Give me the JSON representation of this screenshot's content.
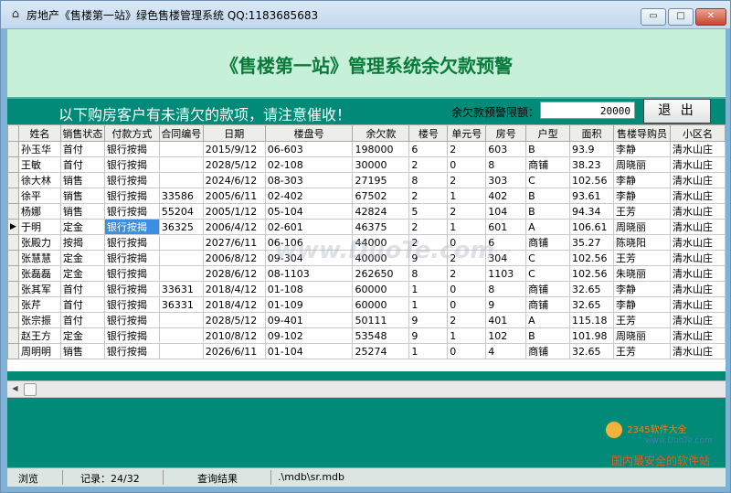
{
  "window": {
    "title": "房地产《售楼第一站》绿色售楼管理系统  QQ:1183685683",
    "minimize": "▭",
    "maximize": "□",
    "close": "✕"
  },
  "banner": {
    "title": "《售楼第一站》管理系统余欠款预警"
  },
  "toolbar": {
    "notice": "以下购房客户有未清欠的款项，请注意催收！",
    "threshold_label": "余欠款预警限额：",
    "threshold_value": "20000",
    "exit_label": "退 出"
  },
  "table": {
    "columns": [
      "姓名",
      "销售状态",
      "付款方式",
      "合同编号",
      "日期",
      "楼盘号",
      "余欠款",
      "楼号",
      "单元号",
      "房号",
      "户型",
      "面积",
      "售楼导购员",
      "小区名"
    ],
    "rows": [
      [
        "孙玉华",
        "首付",
        "银行按揭",
        "",
        "2015/9/12",
        "06-603",
        "198000",
        "6",
        "2",
        "603",
        "B",
        "93.9",
        "李静",
        "清水山庄"
      ],
      [
        "王敏",
        "首付",
        "银行按揭",
        "",
        "2028/5/12",
        "02-108",
        "30000",
        "2",
        "0",
        "8",
        "商铺",
        "38.23",
        "周晓丽",
        "清水山庄"
      ],
      [
        "徐大林",
        "销售",
        "银行按揭",
        "",
        "2024/6/12",
        "08-303",
        "27195",
        "8",
        "2",
        "303",
        "C",
        "102.56",
        "李静",
        "清水山庄"
      ],
      [
        "徐平",
        "销售",
        "银行按揭",
        "33586",
        "2005/6/11",
        "02-402",
        "67502",
        "2",
        "1",
        "402",
        "B",
        "93.61",
        "李静",
        "清水山庄"
      ],
      [
        "杨娜",
        "销售",
        "银行按揭",
        "55204",
        "2005/1/12",
        "05-104",
        "42824",
        "5",
        "2",
        "104",
        "B",
        "94.34",
        "王芳",
        "清水山庄"
      ],
      [
        "于明",
        "定金",
        "银行按揭",
        "36325",
        "2006/4/12",
        "02-601",
        "46375",
        "2",
        "1",
        "601",
        "A",
        "106.61",
        "周晓丽",
        "清水山庄"
      ],
      [
        "张殿力",
        "按揭",
        "银行按揭",
        "",
        "2027/6/11",
        "06-106",
        "44000",
        "2",
        "0",
        "6",
        "商铺",
        "35.27",
        "陈晓阳",
        "清水山庄"
      ],
      [
        "张慧慧",
        "定金",
        "银行按揭",
        "",
        "2006/8/12",
        "09-304",
        "40000",
        "9",
        "2",
        "304",
        "C",
        "102.56",
        "王芳",
        "清水山庄"
      ],
      [
        "张磊磊",
        "定金",
        "银行按揭",
        "",
        "2028/6/12",
        "08-1103",
        "262650",
        "8",
        "2",
        "1103",
        "C",
        "102.56",
        "朱晓丽",
        "清水山庄"
      ],
      [
        "张其军",
        "首付",
        "银行按揭",
        "33631",
        "2018/4/12",
        "01-108",
        "60000",
        "1",
        "0",
        "8",
        "商铺",
        "32.65",
        "李静",
        "清水山庄"
      ],
      [
        "张芹",
        "首付",
        "银行按揭",
        "36331",
        "2018/4/12",
        "01-109",
        "60000",
        "1",
        "0",
        "9",
        "商铺",
        "32.65",
        "李静",
        "清水山庄"
      ],
      [
        "张宗振",
        "首付",
        "银行按揭",
        "",
        "2028/5/12",
        "09-401",
        "50111",
        "9",
        "2",
        "401",
        "A",
        "115.18",
        "王芳",
        "清水山庄"
      ],
      [
        "赵王方",
        "定金",
        "银行按揭",
        "",
        "2010/8/12",
        "09-102",
        "53548",
        "9",
        "1",
        "102",
        "B",
        "101.98",
        "周晓丽",
        "清水山庄"
      ],
      [
        "周明明",
        "销售",
        "银行按揭",
        "",
        "2026/6/11",
        "01-104",
        "25274",
        "1",
        "0",
        "4",
        "商铺",
        "32.65",
        "王芳",
        "清水山庄"
      ]
    ],
    "current_row": 5,
    "selected_cell": [
      5,
      2
    ]
  },
  "statusbar": {
    "mode": "浏览",
    "record": "记录：24/32",
    "query": "查询结果",
    "path": ".\\mdb\\sr.mdb"
  },
  "watermark": "www.DuoTe.com",
  "logo": {
    "brand": "2345软件大全",
    "site": "www.DuoTe.com",
    "slogan": "国内最安全的软件站"
  }
}
